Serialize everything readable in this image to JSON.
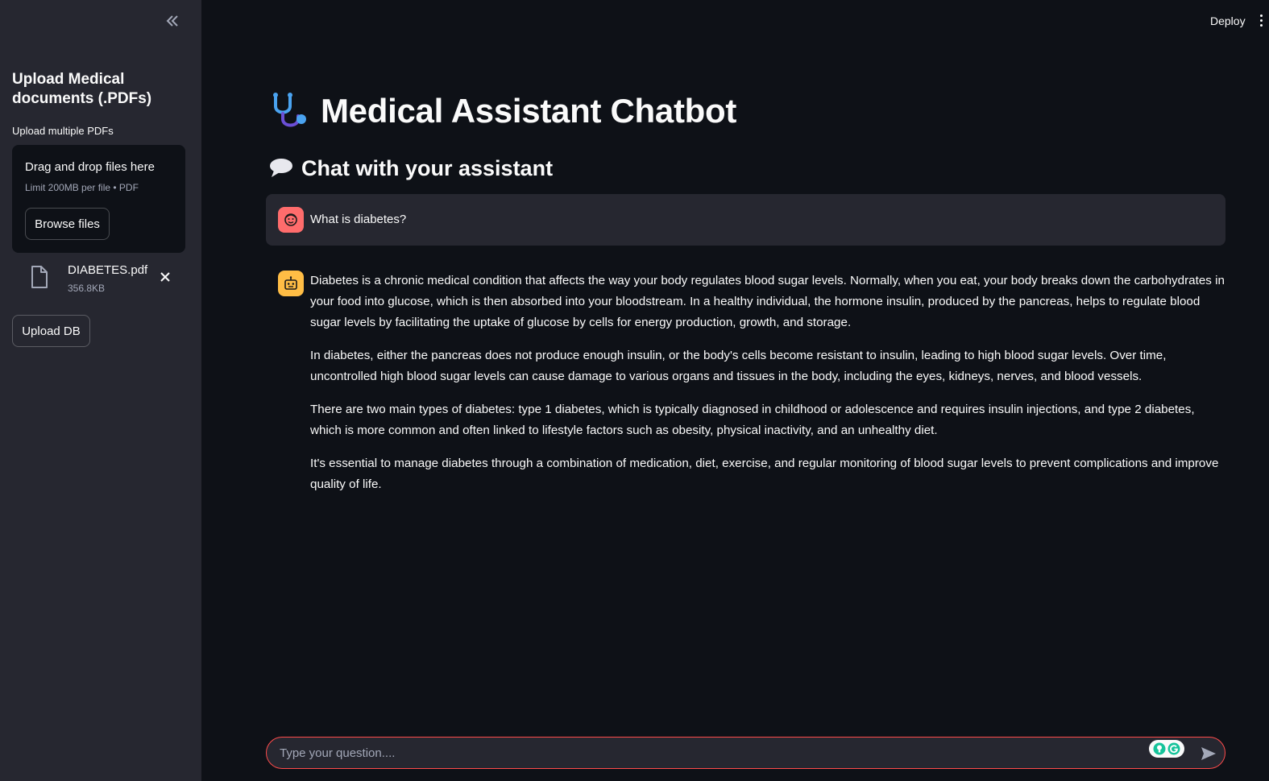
{
  "sidebar": {
    "title": "Upload Medical documents (.PDFs)",
    "uploader_label": "Upload multiple PDFs",
    "dropzone": {
      "main_text": "Drag and drop files here",
      "limit_text": "Limit 200MB per file • PDF",
      "browse_label": "Browse files"
    },
    "files": [
      {
        "name": "DIABETES.pdf",
        "size": "356.8KB"
      }
    ],
    "upload_db_label": "Upload DB"
  },
  "header": {
    "deploy_label": "Deploy"
  },
  "main": {
    "title": "Medical Assistant Chatbot",
    "title_icon": "stethoscope-icon",
    "subheader": "Chat with your assistant",
    "subheader_icon": "speech-bubble-icon"
  },
  "chat": {
    "messages": [
      {
        "role": "user",
        "avatar": "user-face-icon",
        "avatar_color": "#ff6c6c",
        "text": "What is diabetes?"
      },
      {
        "role": "assistant",
        "avatar": "robot-icon",
        "avatar_color": "#ffbd45",
        "paragraphs": [
          "Diabetes is a chronic medical condition that affects the way your body regulates blood sugar levels. Normally, when you eat, your body breaks down the carbohydrates in your food into glucose, which is then absorbed into your bloodstream. In a healthy individual, the hormone insulin, produced by the pancreas, helps to regulate blood sugar levels by facilitating the uptake of glucose by cells for energy production, growth, and storage.",
          "In diabetes, either the pancreas does not produce enough insulin, or the body's cells become resistant to insulin, leading to high blood sugar levels. Over time, uncontrolled high blood sugar levels can cause damage to various organs and tissues in the body, including the eyes, kidneys, nerves, and blood vessels.",
          "There are two main types of diabetes: type 1 diabetes, which is typically diagnosed in childhood or adolescence and requires insulin injections, and type 2 diabetes, which is more common and often linked to lifestyle factors such as obesity, physical inactivity, and an unhealthy diet.",
          "It's essential to manage diabetes through a combination of medication, diet, exercise, and regular monitoring of blood sugar levels to prevent complications and improve quality of life."
        ]
      }
    ],
    "input": {
      "placeholder": "Type your question....",
      "value": ""
    }
  },
  "colors": {
    "background": "#0e1117",
    "sidebar": "#262730",
    "accent": "#ff4b4b",
    "text": "#fafafa"
  }
}
